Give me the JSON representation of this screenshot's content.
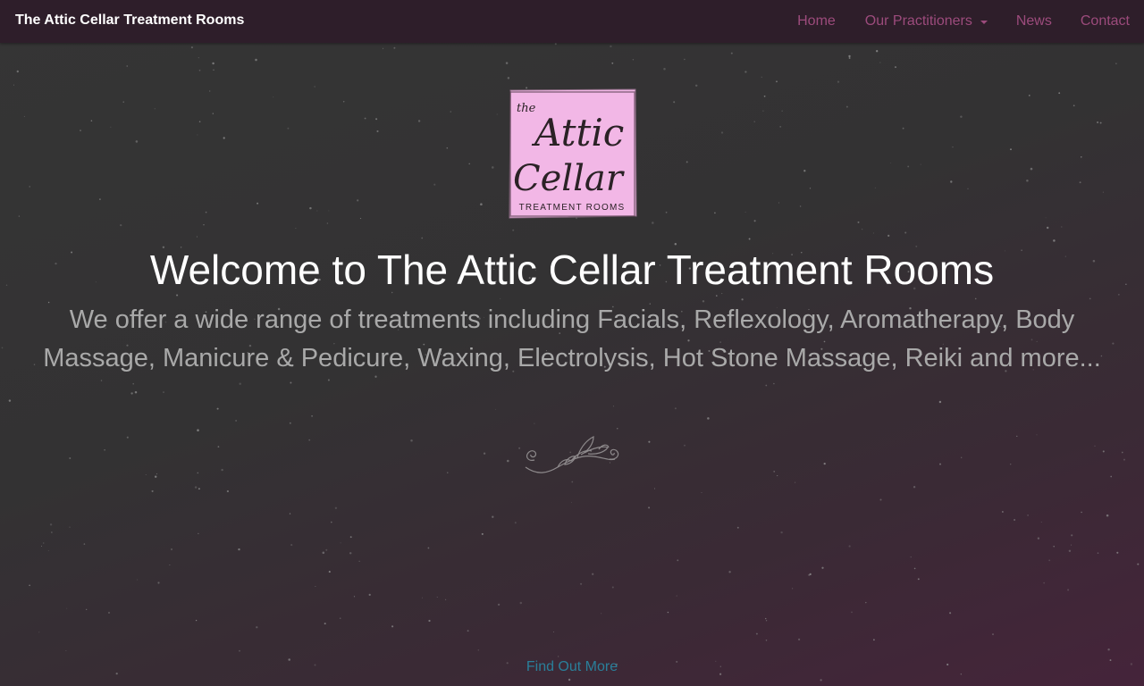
{
  "navbar": {
    "brand": "The Attic Cellar Treatment Rooms",
    "links": [
      {
        "label": "Home"
      },
      {
        "label": "Our Practitioners",
        "has_dropdown": true
      },
      {
        "label": "News"
      },
      {
        "label": "Contact"
      }
    ],
    "link_color": "#9c4b7c",
    "background": "#2e1e2a"
  },
  "hero": {
    "logo": {
      "icon": "attic-cellar-logo",
      "line1": "the",
      "line2": "Attic",
      "line3": "Cellar",
      "line4": "TREATMENT ROOMS",
      "background": "#f2b7e6"
    },
    "title": "Welcome to The Attic Cellar Treatment Rooms",
    "intro": "We offer a wide range of treatments including Facials, Reflexology, Aromatherapy, Body Massage, Manicure & Pedicure, Waxing, Electrolysis, Hot Stone Massage, Reiki and more...",
    "divider_icon": "floral-swirl-divider-icon",
    "cta_label": "Find Out More",
    "cta_color": "#2a7f9a"
  }
}
